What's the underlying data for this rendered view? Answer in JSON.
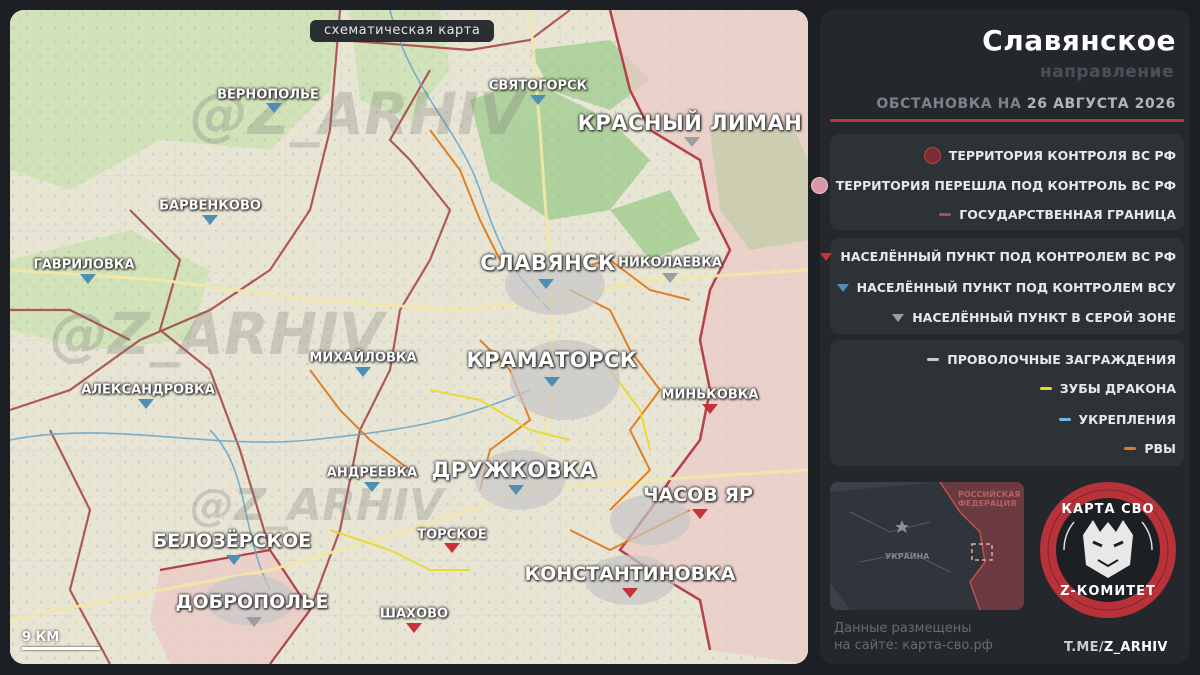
{
  "map": {
    "tag": "схематическая карта",
    "watermark": "@Z_ARHIV",
    "scale_label": "9 КМ",
    "cities": [
      {
        "name": "СВЯТОГОРСК",
        "size": "small",
        "status": "ua"
      },
      {
        "name": "КРАСНЫЙ ЛИМАН",
        "size": "big",
        "status": "grey"
      },
      {
        "name": "ВЕРНОПОЛЬЕ",
        "size": "small",
        "status": "ua"
      },
      {
        "name": "БАРВЕНКОВО",
        "size": "small",
        "status": "ua"
      },
      {
        "name": "ГАВРИЛОВКА",
        "size": "small",
        "status": "ua"
      },
      {
        "name": "СЛАВЯНСК",
        "size": "big",
        "status": "ua"
      },
      {
        "name": "НИКОЛАЕВКА",
        "size": "small",
        "status": "grey"
      },
      {
        "name": "МИХАЙЛОВКА",
        "size": "small",
        "status": "ua"
      },
      {
        "name": "КРАМАТОРСК",
        "size": "big",
        "status": "ua"
      },
      {
        "name": "АЛЕКСАНДРОВКА",
        "size": "small",
        "status": "ua"
      },
      {
        "name": "МИНЬКОВКА",
        "size": "small",
        "status": "ru"
      },
      {
        "name": "АНДРЕЕВКА",
        "size": "small",
        "status": "ua"
      },
      {
        "name": "ДРУЖКОВКА",
        "size": "big",
        "status": "ua"
      },
      {
        "name": "ЧАСОВ ЯР",
        "size": "mid",
        "status": "ru"
      },
      {
        "name": "ТОРСКОЕ",
        "size": "small",
        "status": "ru"
      },
      {
        "name": "БЕЛОЗЁРСКОЕ",
        "size": "mid",
        "status": "ua"
      },
      {
        "name": "КОНСТАНТИНОВКА",
        "size": "mid",
        "status": "ru"
      },
      {
        "name": "ДОБРОПОЛЬЕ",
        "size": "mid",
        "status": "grey"
      },
      {
        "name": "ШАХОВО",
        "size": "small",
        "status": "ru"
      }
    ]
  },
  "panel": {
    "title": "Славянское",
    "subtitle": "направление",
    "date_prefix": "ОБСТАНОВКА НА",
    "date_value": "26 АВГУСТА 2026",
    "legend_territory": [
      {
        "label": "ТЕРРИТОРИЯ КОНТРОЛЯ ВС РФ",
        "kind": "circle",
        "color": "#7a2e34"
      },
      {
        "label": "ТЕРРИТОРИЯ ПЕРЕШЛА ПОД КОНТРОЛЬ ВС РФ",
        "kind": "circle",
        "color": "#d89aa8"
      },
      {
        "label": "ГОСУДАРСТВЕННАЯ ГРАНИЦА",
        "kind": "line",
        "color": "#a85050"
      }
    ],
    "legend_settlements": [
      {
        "label": "НАСЕЛЁННЫЙ ПУНКТ ПОД КОНТРОЛЕМ ВС РФ",
        "color": "#c8303a"
      },
      {
        "label": "НАСЕЛЁННЫЙ ПУНКТ ПОД КОНТРОЛЕМ ВСУ",
        "color": "#4f8fb5"
      },
      {
        "label": "НАСЕЛЁННЫЙ ПУНКТ В СЕРОЙ ЗОНЕ",
        "color": "#9a9ea3"
      }
    ],
    "legend_defense": [
      {
        "label": "ПРОВОЛОЧНЫЕ ЗАГРАЖДЕНИЯ",
        "color": "#c9c9c9"
      },
      {
        "label": "ЗУБЫ ДРАКОНА",
        "color": "#e8d82a"
      },
      {
        "label": "УКРЕПЛЕНИЯ",
        "color": "#6fb7e3"
      },
      {
        "label": "РВЫ",
        "color": "#e07a1c"
      }
    ],
    "minimap": {
      "ru_label": "РОССИЙСКАЯ ФЕДЕРАЦИЯ",
      "ua_label": "УКРАИНА"
    },
    "logo": {
      "top_text": "КАРТА СВО",
      "bottom_text": "Z-КОМИТЕТ"
    },
    "footer_line1": "Данные размещены",
    "footer_line2": "на сайте: карта-сво.рф",
    "tme_prefix": "T.ME/",
    "tme_handle": "Z_ARHIV"
  }
}
